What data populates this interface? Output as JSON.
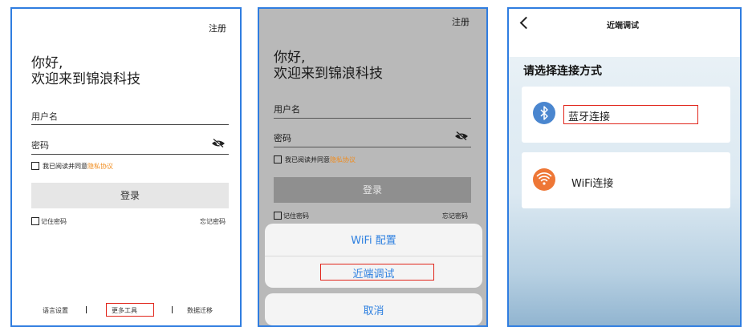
{
  "login": {
    "register": "注册",
    "greeting_line1": "你好,",
    "greeting_line2": "欢迎来到锦浪科技",
    "username_label": "用户名",
    "password_label": "密码",
    "agree_text": "我已阅读并同意",
    "privacy_link": "隐私协议",
    "login_button": "登录",
    "remember": "记住密码",
    "forgot": "忘记密码",
    "language": "语言设置",
    "more_tools": "更多工具",
    "data_migration": "数据迁移"
  },
  "action_sheet": {
    "wifi_config": "WiFi 配置",
    "near_debug": "近端调试",
    "cancel": "取消"
  },
  "near_debug_page": {
    "title": "近端调试",
    "heading": "请选择连接方式",
    "bluetooth": "蓝牙连接",
    "wifi": "WiFi连接"
  },
  "colors": {
    "frame_border": "#2f7de0",
    "highlight_box": "#e1251b",
    "privacy_link": "#f08c1e",
    "sheet_text": "#2c7fe0",
    "bluetooth_icon": "#4a86cf",
    "wifi_icon": "#ee7736"
  },
  "icons": [
    "eye-slash-icon",
    "checkbox-icon",
    "bluetooth-icon",
    "wifi-icon",
    "back-chevron-icon"
  ]
}
